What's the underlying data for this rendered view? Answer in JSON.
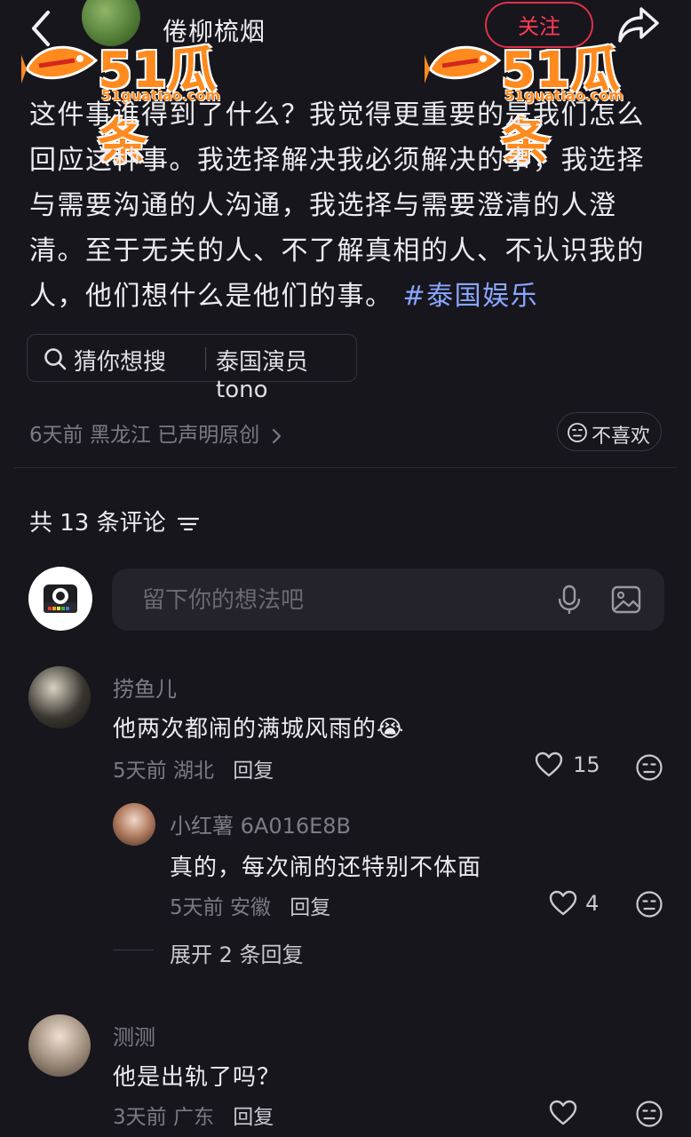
{
  "header": {
    "author_name": "倦柳梳烟",
    "follow_label": "关注",
    "watermark_text": "51瓜条",
    "watermark_url": "51guatiao.com"
  },
  "post": {
    "body": "这件事谁得到了什么？我觉得更重要的是我们怎么回应这种事。我选择解决我必须解决的事，我选择与需要沟通的人沟通，我选择与需要澄清的人澄清。至于无关的人、不了解真相的人、不认识我的人，他们想什么是他们的事。",
    "hashtag": "#泰国娱乐",
    "search_chip": {
      "label": "猜你想搜",
      "query": "泰国演员 tono"
    },
    "meta": "6天前 黑龙江 已声明原创",
    "dislike_label": "不喜欢"
  },
  "comments_section": {
    "title": "共 13 条评论",
    "input_placeholder": "留下你的想法吧"
  },
  "comments": [
    {
      "name": "捞鱼儿",
      "text": "他两次都闹的满城风雨的",
      "emoji": "😭",
      "time": "5天前",
      "location": "湖北",
      "reply_label": "回复",
      "likes": "15"
    },
    {
      "name": "测测",
      "text": "他是出轨了吗？",
      "time": "3天前",
      "location": "广东",
      "reply_label": "回复",
      "likes": ""
    }
  ],
  "reply": {
    "name": "小红薯 6A016E8B",
    "text": "真的，每次闹的还特别不体面",
    "time": "5天前",
    "location": "安徽",
    "reply_label": "回复",
    "likes": "4",
    "expand_label": "展开 2 条回复"
  },
  "colors": {
    "background": "#17161d",
    "follow_red": "#ff3b55",
    "hashtag_blue": "#8aa6ff",
    "watermark_orange": "#ff8a1e"
  }
}
